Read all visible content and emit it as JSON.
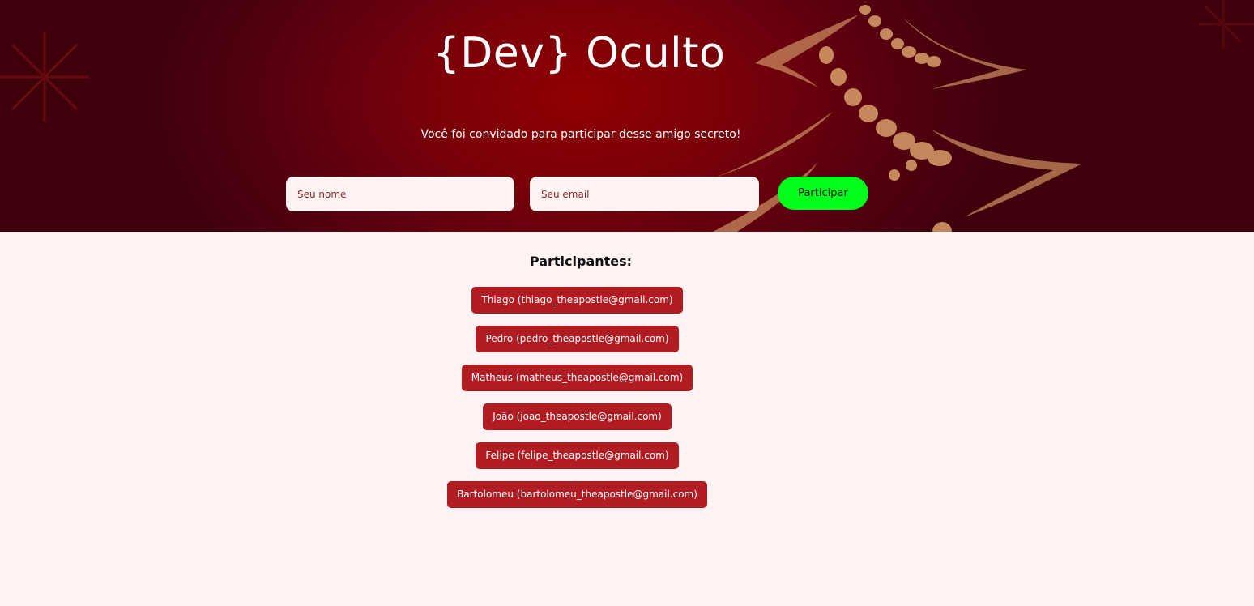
{
  "header": {
    "title": "{Dev} Oculto",
    "subtitle": "Você foi convidado para participar desse amigo secreto!",
    "background_color": "#8f0000"
  },
  "form": {
    "name_placeholder": "Seu nome",
    "email_placeholder": "Seu email",
    "name_value": "",
    "email_value": "",
    "submit_label": "Participar",
    "submit_color": "#00ff1a"
  },
  "participants": {
    "title": "Participantes:",
    "chip_color": "#b01c22",
    "items": [
      {
        "label": "Thiago (thiago_theapostle@gmail.com)"
      },
      {
        "label": "Pedro (pedro_theapostle@gmail.com)"
      },
      {
        "label": "Matheus (matheus_theapostle@gmail.com)"
      },
      {
        "label": "João (joao_theapostle@gmail.com)"
      },
      {
        "label": "Felipe (felipe_theapostle@gmail.com)"
      },
      {
        "label": "Bartolomeu (bartolomeu_theapostle@gmail.com)"
      }
    ]
  }
}
